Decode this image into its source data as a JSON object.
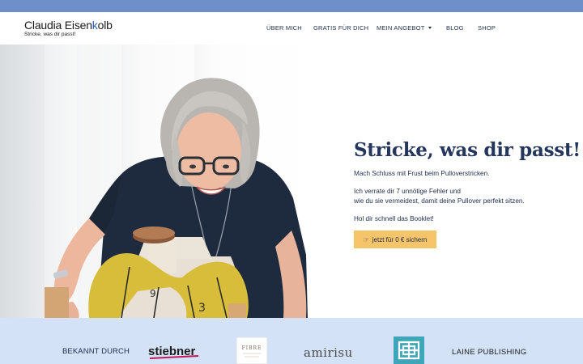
{
  "header": {
    "logo_name_pre": "Claudia Eisen",
    "logo_name_accent": "k",
    "logo_name_post": "olb",
    "tagline": "Stricke, was dir passt!"
  },
  "nav": {
    "items": [
      {
        "label": "ÜBER MICH"
      },
      {
        "label": "GRATIS FÜR DICH"
      },
      {
        "label": "MEIN ANGEBOT"
      },
      {
        "label": "BLOG"
      },
      {
        "label": "SHOP"
      }
    ]
  },
  "hero": {
    "title": "Stricke, was dir passt!",
    "p1": "Mach Schluss mit Frust beim Pulloverstricken.",
    "p2_line1": "Ich verrate dir 7 unnötige Fehler und",
    "p2_line2": "wie du sie vermeidest, damit deine Pullover perfekt sitzen.",
    "p3": "Hol dir schnell das Booklet!",
    "cta_label": "jetzt für 0 € sichern",
    "cta_icon": "hand-point-right-icon"
  },
  "press": {
    "label": "BEKANNT DURCH",
    "logos": [
      {
        "name": "stiebner",
        "text": "stiebner"
      },
      {
        "name": "fibre",
        "text": "FIBRE"
      },
      {
        "name": "amirisu",
        "text": "amirisu"
      },
      {
        "name": "knot-emblem",
        "text": ""
      },
      {
        "name": "laine",
        "text": "LAINE PUBLISHING"
      }
    ]
  },
  "colors": {
    "topbar": "#6e8fc9",
    "navy": "#24365c",
    "cta": "#f6c46a",
    "press_band": "#d3e2f6",
    "stiebner_accent": "#c2185b",
    "emblem": "#3ea6b8"
  }
}
